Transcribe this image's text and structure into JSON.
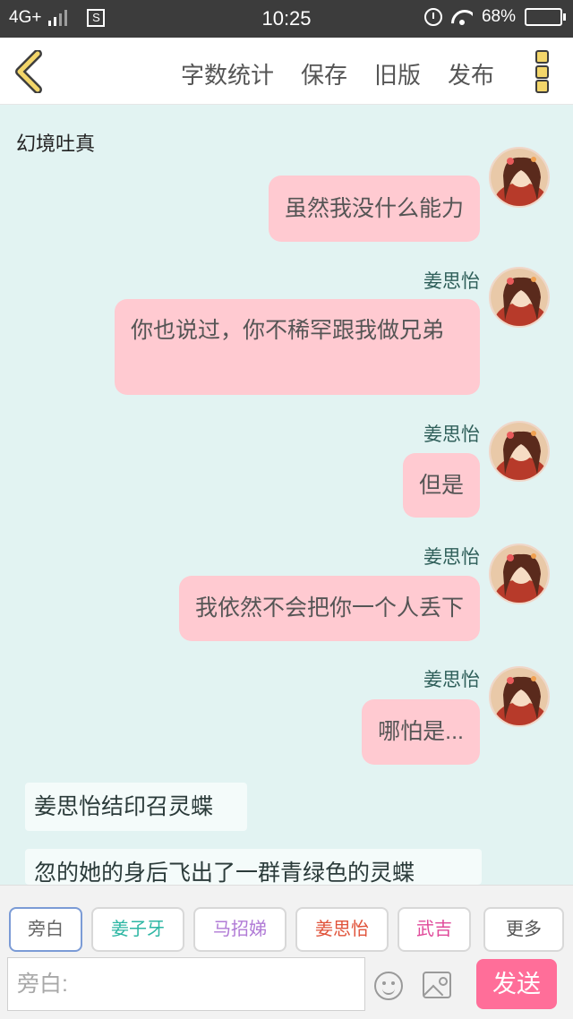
{
  "status_bar": {
    "network": "4G+",
    "time": "10:25",
    "battery": "68%"
  },
  "toolbar": {
    "word_count": "字数统计",
    "save": "保存",
    "old_version": "旧版",
    "publish": "发布"
  },
  "story": {
    "title": "幻境吐真"
  },
  "messages": [
    {
      "sender": "",
      "text": "虽然我没什么能力"
    },
    {
      "sender": "姜思怡",
      "text": "你也说过，你不稀罕跟我做兄弟"
    },
    {
      "sender": "姜思怡",
      "text": "但是"
    },
    {
      "sender": "姜思怡",
      "text": "我依然不会把你一个人丢下"
    },
    {
      "sender": "姜思怡",
      "text": "哪怕是..."
    }
  ],
  "narrations": [
    {
      "text": "姜思怡结印召灵蝶"
    },
    {
      "text": "忽的她的身后飞出了一群青绿色的灵蝶"
    }
  ],
  "characters": [
    {
      "name": "旁白",
      "color": "#666666",
      "selected": true
    },
    {
      "name": "姜子牙",
      "color": "#2db6a3"
    },
    {
      "name": "马招娣",
      "color": "#b07ad6"
    },
    {
      "name": "姜思怡",
      "color": "#e0533a"
    },
    {
      "name": "武吉",
      "color": "#e04a9a"
    }
  ],
  "more_label": "更多",
  "input": {
    "placeholder": "旁白:"
  },
  "send_label": "发送",
  "colors": {
    "bubble": "#ffcad1",
    "send": "#ff6e99",
    "background": "#e2f3f2"
  }
}
